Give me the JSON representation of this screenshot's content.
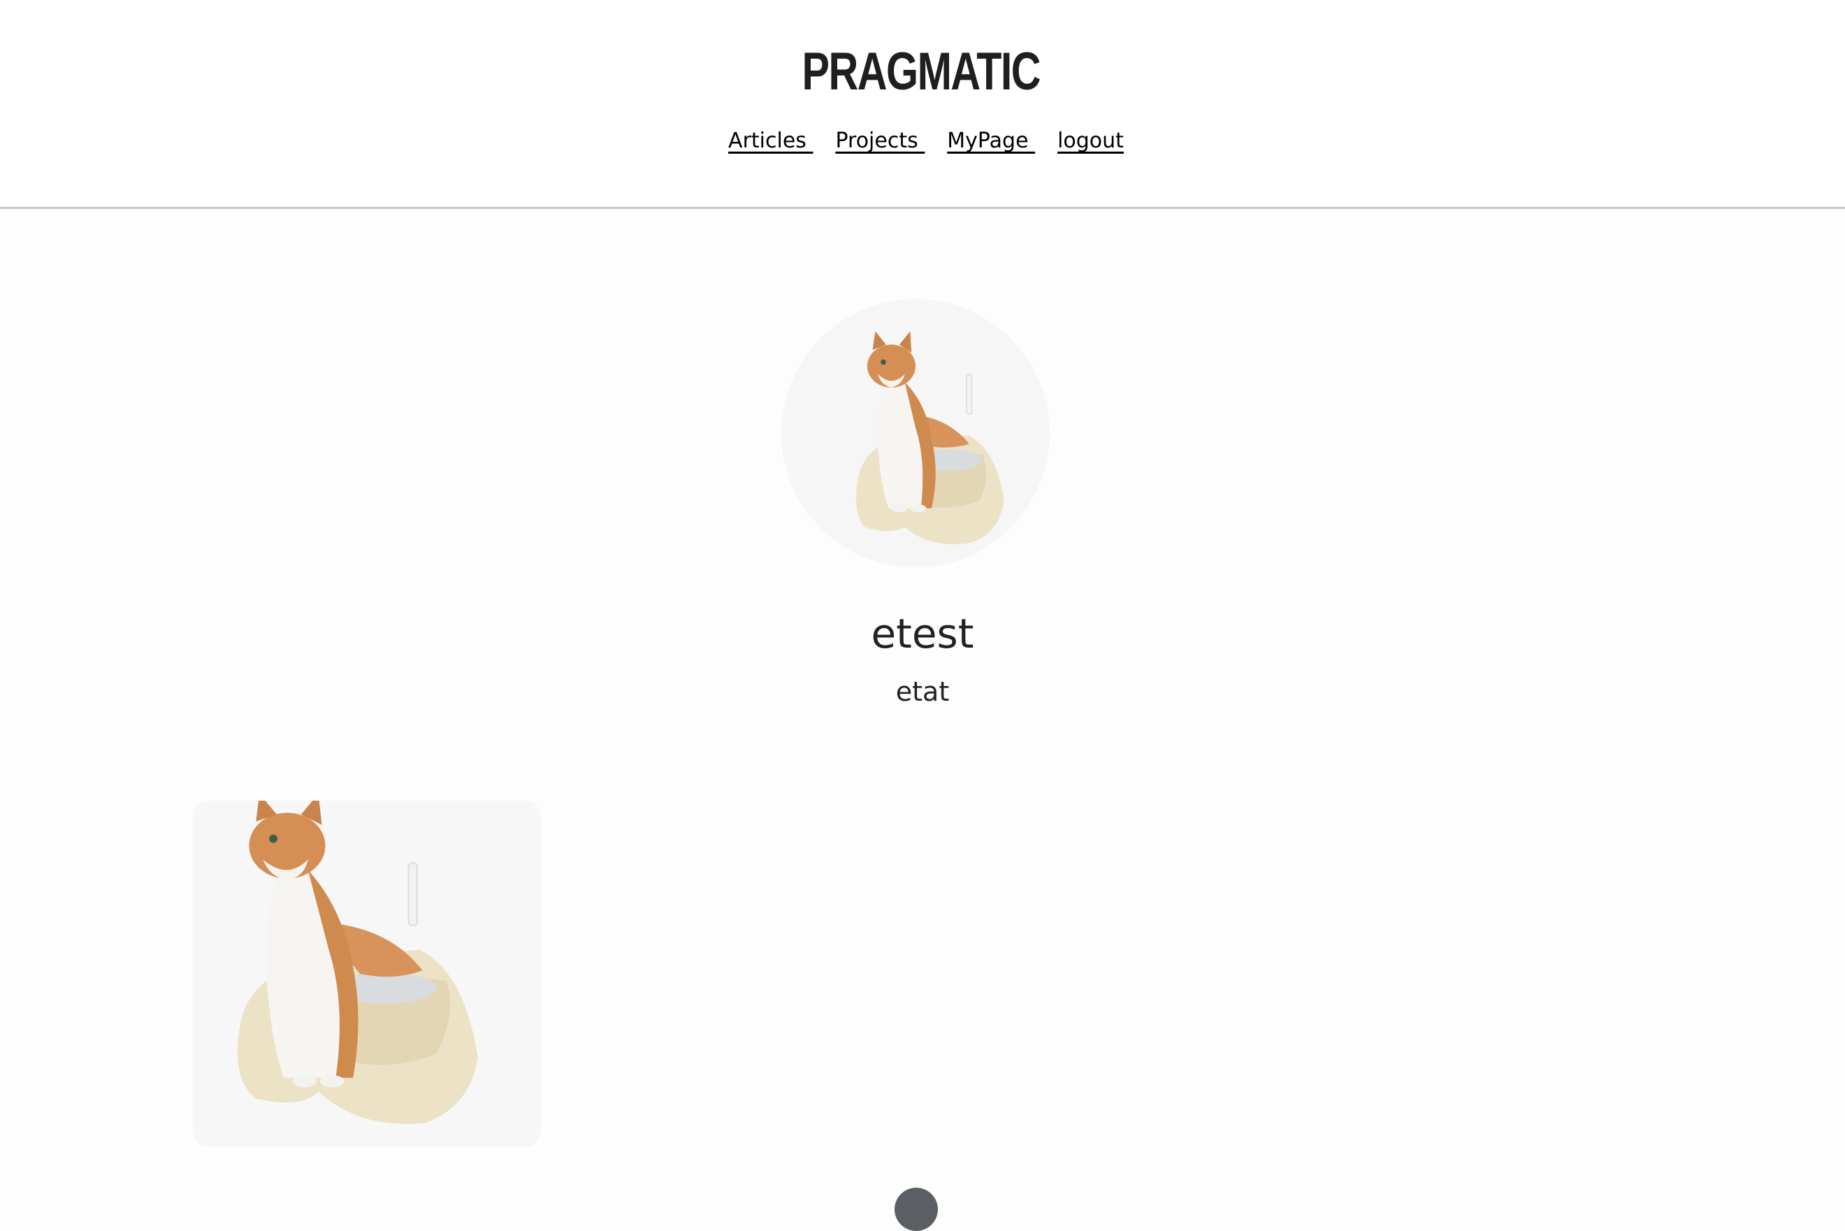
{
  "header": {
    "logo": "PRAGMATIC",
    "nav": [
      {
        "label": "Articles "
      },
      {
        "label": "Projects "
      },
      {
        "label": "MyPage "
      },
      {
        "label": "logout"
      }
    ]
  },
  "profile": {
    "nickname": "etest",
    "message": "etat",
    "avatar_icon": "cat-in-litter-box-photo"
  },
  "articles": [
    {
      "image_icon": "cat-in-litter-box-photo"
    }
  ],
  "colors": {
    "header_bg": "#ffffff",
    "divider": "#c8c8c8",
    "page_bg": "#fdfdfd",
    "fab": "#5b5f63"
  }
}
